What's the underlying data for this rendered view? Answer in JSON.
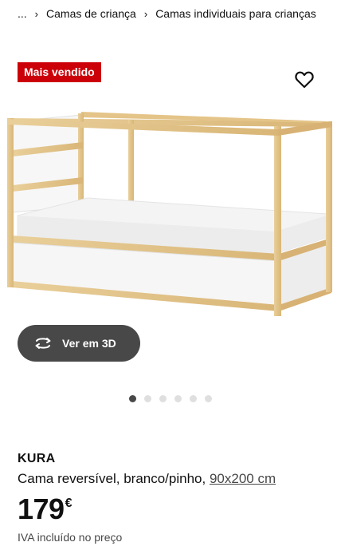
{
  "breadcrumb": {
    "ellipsis": "...",
    "items": [
      "Camas de criança",
      "Camas individuais para crianças"
    ]
  },
  "badge": {
    "label": "Mais vendido",
    "color": "#cc0008"
  },
  "favorite": {
    "icon": "heart-outline-icon"
  },
  "view3d": {
    "label": "Ver em 3D",
    "icon": "rotate-3d-icon"
  },
  "carousel": {
    "count": 6,
    "active": 0
  },
  "product": {
    "name": "KURA",
    "description": "Cama reversível, branco/pinho, ",
    "size": "90x200 cm",
    "price": "179",
    "currency": "€",
    "vat_note": "IVA incluído no preço"
  }
}
